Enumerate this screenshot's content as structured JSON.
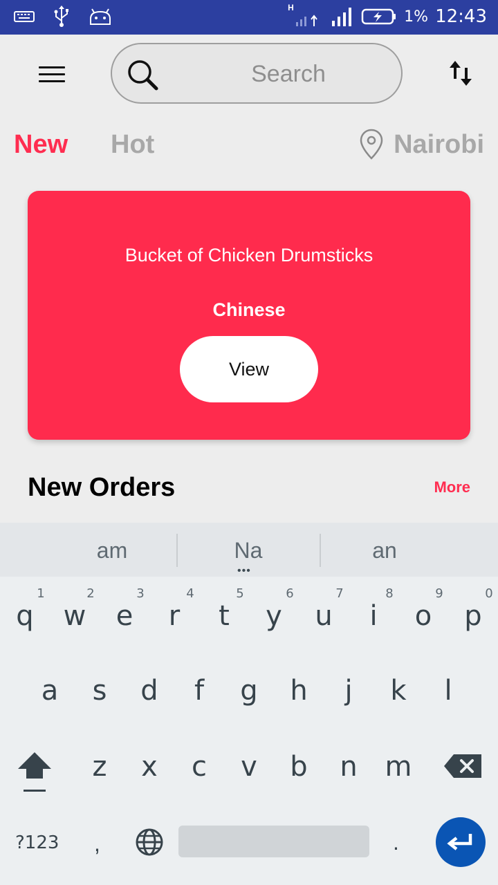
{
  "status_bar": {
    "network_type": "H",
    "battery_percent": "1%",
    "time": "12:43",
    "left_icons": [
      "keyboard-icon",
      "usb-icon",
      "android-debug-icon"
    ],
    "right_icons": [
      "data-signal-icon",
      "signal-bars-icon",
      "battery-charging-icon"
    ]
  },
  "app_bar": {
    "search_placeholder": "Search",
    "icons": [
      "menu-icon",
      "search-icon",
      "sort-icon"
    ]
  },
  "tabs": [
    {
      "label": "New",
      "active": true
    },
    {
      "label": "Hot",
      "active": false
    }
  ],
  "location": {
    "label": "Nairobi",
    "icon": "location-pin-icon"
  },
  "featured_card": {
    "title": "Bucket of Chicken Drumsticks",
    "category": "Chinese",
    "button_label": "View"
  },
  "section": {
    "title": "New Orders",
    "more_label": "More"
  },
  "keyboard": {
    "suggestions": [
      "am",
      "Na",
      "an"
    ],
    "row1": [
      {
        "char": "q",
        "num": "1"
      },
      {
        "char": "w",
        "num": "2"
      },
      {
        "char": "e",
        "num": "3"
      },
      {
        "char": "r",
        "num": "4"
      },
      {
        "char": "t",
        "num": "5"
      },
      {
        "char": "y",
        "num": "6"
      },
      {
        "char": "u",
        "num": "7"
      },
      {
        "char": "i",
        "num": "8"
      },
      {
        "char": "o",
        "num": "9"
      },
      {
        "char": "p",
        "num": "0"
      }
    ],
    "row2": [
      "a",
      "s",
      "d",
      "f",
      "g",
      "h",
      "j",
      "k",
      "l"
    ],
    "row3": [
      "z",
      "x",
      "c",
      "v",
      "b",
      "n",
      "m"
    ],
    "symbols_label": "?123",
    "comma_label": ",",
    "period_label": "."
  },
  "colors": {
    "accent": "#ff2d50",
    "status_bar": "#2c3fa0",
    "card": "#ff2b4d",
    "enter_key": "#0a55b4"
  }
}
